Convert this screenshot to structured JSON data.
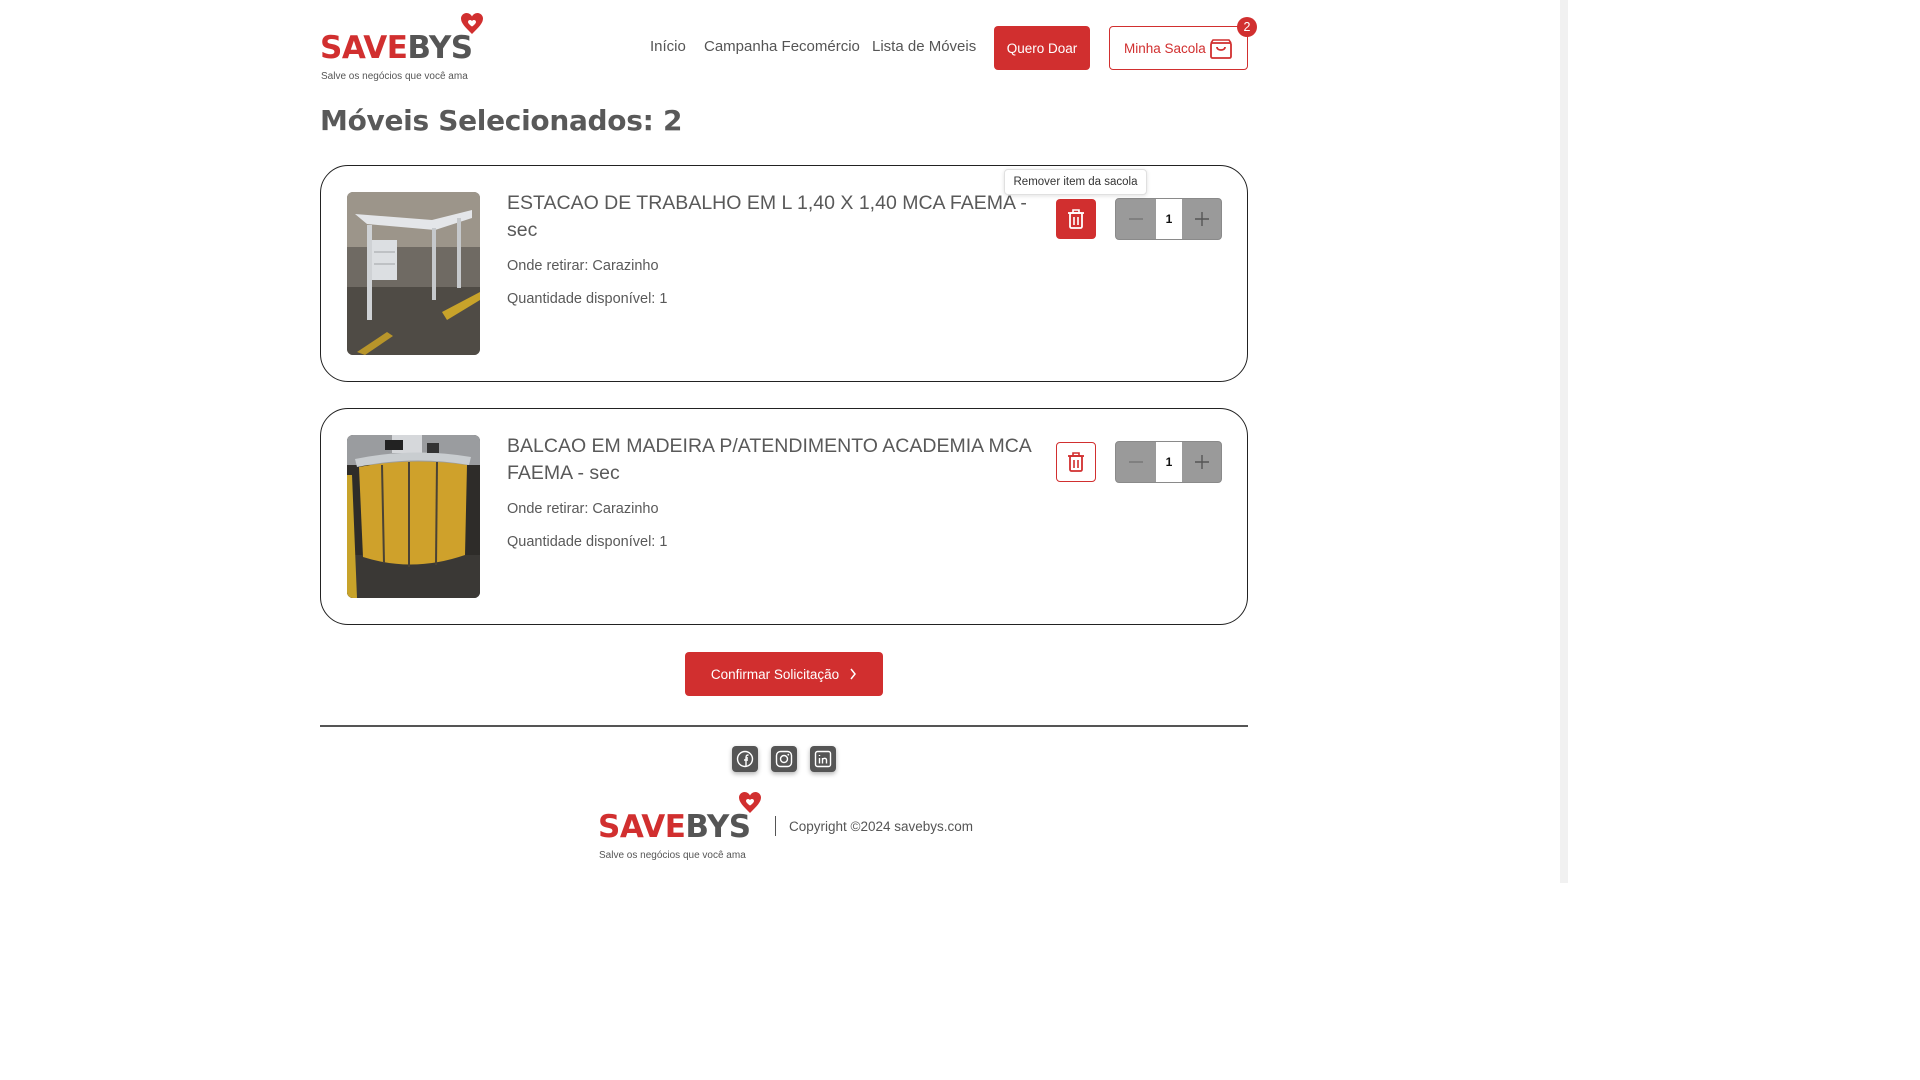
{
  "header": {
    "logo_text_red": "SAVE",
    "logo_text_grey": "BYS",
    "tagline": "Salve os negócios que você ama",
    "nav": {
      "inicio": "Início",
      "campanha": "Campanha Fecomércio",
      "lista": "Lista de Móveis"
    },
    "donate_label": "Quero Doar",
    "bag_label": "Minha Sacola",
    "bag_count": "2"
  },
  "main": {
    "title": "Móveis Selecionados: 2",
    "tooltip": "Remover item da sacola",
    "items": [
      {
        "name": "ESTACAO DE TRABALHO EM L 1,40 X 1,40 MCA FAEMA - sec",
        "where": "Onde retirar: Carazinho",
        "available": "Quantidade disponível: 1",
        "quantity": "1"
      },
      {
        "name": "BALCAO EM MADEIRA P/ATENDIMENTO ACADEMIA MCA FAEMA - sec",
        "where": "Onde retirar: Carazinho",
        "available": "Quantidade disponível: 1",
        "quantity": "1"
      }
    ],
    "confirm_label": "Confirmar Solicitação"
  },
  "footer": {
    "social_icons": [
      "facebook-icon",
      "instagram-icon",
      "linkedin-icon"
    ],
    "logo_text_red": "SAVE",
    "logo_text_grey": "BYS",
    "tagline": "Salve os negócios que você ama",
    "copyright": "Copyright ©2024 savebys.com"
  },
  "colors": {
    "brand_red": "#d12f2f",
    "text_grey": "#595959"
  }
}
